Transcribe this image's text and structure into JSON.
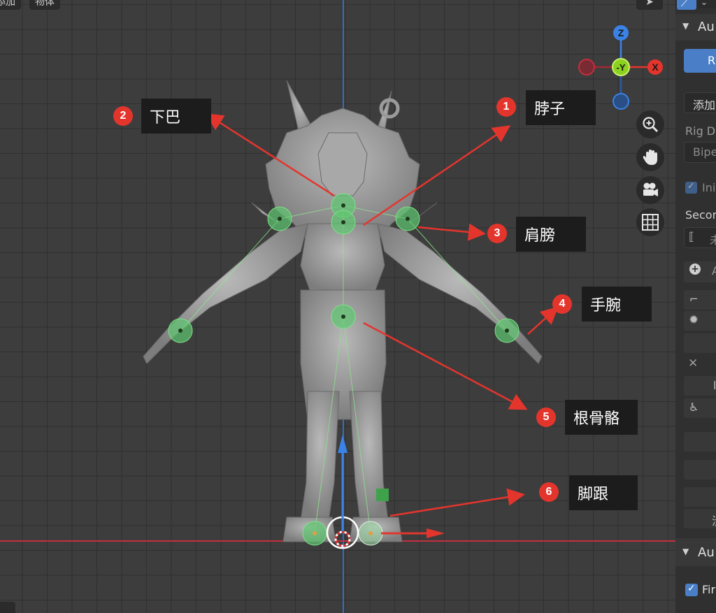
{
  "header": {
    "menu_add": "添加",
    "menu_object": "物体"
  },
  "gizmo": {
    "z": "Z",
    "y": "-Y",
    "x": "X"
  },
  "annotations": [
    {
      "num": "1",
      "label": "脖子"
    },
    {
      "num": "2",
      "label": "下巴"
    },
    {
      "num": "3",
      "label": "肩膀"
    },
    {
      "num": "4",
      "label": "手腕"
    },
    {
      "num": "5",
      "label": "根骨骼"
    },
    {
      "num": "6",
      "label": "脚跟"
    }
  ],
  "sidebar": {
    "panel1_title": "Au",
    "primary_button": "R",
    "add_dropdown": "添加",
    "rig_label": "Rig D",
    "rig_value": "Bipe",
    "checkbox1_label": "Ini",
    "secondary_label": "Secor",
    "secondary_field_text": "未",
    "add_row_text": "A",
    "row_letter": "l",
    "bottom_row_text": "渋",
    "panel2_title": "Au",
    "checkbox2_label": "Fir"
  },
  "colors": {
    "accent_blue": "#4a7fc7",
    "arrow_red": "#e4352d",
    "bone_green": "#5fc770",
    "axis_x": "#c3303e",
    "axis_z": "#2f6fc4"
  }
}
